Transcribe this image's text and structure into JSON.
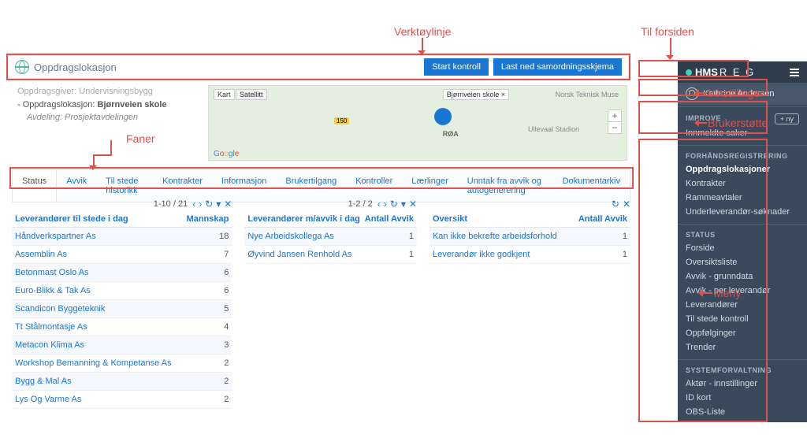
{
  "annotations": {
    "verktoylinje": "Verktøylinje",
    "til_forsiden": "Til forsiden",
    "faner": "Faner",
    "innstillinger": "Innstillinger",
    "brukerstotte": "Brukerstøtte",
    "meny": "Meny"
  },
  "toolbar": {
    "title": "Oppdragslokasjon",
    "start_kontroll": "Start kontroll",
    "last_ned": "Last ned samordningsskjema"
  },
  "info": {
    "line1": "Oppdragsgiver: Undervisningsbygg",
    "line2_label": "- Oppdragslokasjon: ",
    "line2_value": "Bjørnveien skole",
    "line3": "Avdeling: Prosjektavdelingen"
  },
  "map": {
    "kart": "Kart",
    "satellitt": "Satellitt",
    "pin_label": "Bjørnveien skole",
    "ullevaal": "Ullevaal Stadion",
    "norsk": "Norsk Teknisk Muse",
    "roa": "RØA",
    "road": "150"
  },
  "tabs": [
    "Status",
    "Avvik",
    "Til stede historikk",
    "Kontrakter",
    "Informasjon",
    "Brukertilgang",
    "Kontroller",
    "Lærlinger",
    "Unntak fra avvik og autogenerering",
    "Dokumentarkiv"
  ],
  "table1": {
    "pager": "1-10 / 21",
    "head_a": "Leverandører til stede i dag",
    "head_b": "Mannskap",
    "rows": [
      {
        "a": "Håndverkspartner As",
        "b": "18"
      },
      {
        "a": "Assemblin As",
        "b": "7"
      },
      {
        "a": "Betonmast Oslo As",
        "b": "6"
      },
      {
        "a": "Euro-Blikk & Tak As",
        "b": "6"
      },
      {
        "a": "Scandicon Byggeteknik",
        "b": "5"
      },
      {
        "a": "Tt Stålmontasje As",
        "b": "4"
      },
      {
        "a": "Metacon Klima As",
        "b": "3"
      },
      {
        "a": "Workshop Bemanning & Kompetanse As",
        "b": "2"
      },
      {
        "a": "Bygg & Mal As",
        "b": "2"
      },
      {
        "a": "Lys Og Varme As",
        "b": "2"
      }
    ]
  },
  "table2": {
    "pager": "1-2 / 2",
    "head_a": "Leverandører m/avvik i dag",
    "head_b": "Antall Avvik",
    "rows": [
      {
        "a": "Nye Arbeidskollega As",
        "b": "1"
      },
      {
        "a": "Øyvind Jansen Renhold As",
        "b": "1"
      }
    ]
  },
  "table3": {
    "head_a": "Oversikt",
    "head_b": "Antall Avvik",
    "rows": [
      {
        "a": "Kan ikke bekrefte arbeidsforhold",
        "b": "1"
      },
      {
        "a": "Leverandør ikke godkjent",
        "b": "1"
      }
    ]
  },
  "sidebar": {
    "brand_bold": "HMS",
    "brand_thin": "R E G",
    "user": "Kathrine Andersen",
    "improve_title": "IMPROVE",
    "improve_item": "Innmeldte saker",
    "ny_btn": "+ ny",
    "sections": [
      {
        "title": "FORHÅNDSREGISTRERING",
        "items": [
          "Oppdragslokasjoner",
          "Kontrakter",
          "Rammeavtaler",
          "Underleverandør-søknader"
        ],
        "active": 0
      },
      {
        "title": "STATUS",
        "items": [
          "Forside",
          "Oversiktsliste",
          "Avvik - grunndata",
          "Avvik - per leverandør",
          "Leverandører",
          "Til stede kontroll",
          "Oppfølginger",
          "Trender"
        ]
      },
      {
        "title": "SYSTEMFORVALTNING",
        "items": [
          "Aktør - innstillinger",
          "ID kort",
          "OBS-Liste"
        ]
      }
    ]
  }
}
